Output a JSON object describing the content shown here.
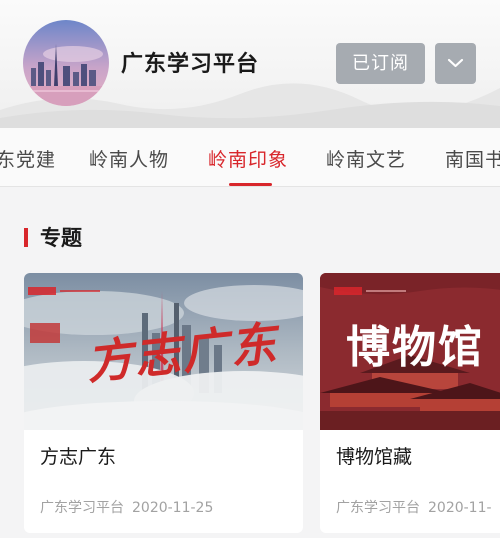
{
  "header": {
    "channel_name": "广东学习平台",
    "subscribe_label": "已订阅"
  },
  "tabs": [
    {
      "label": "东党建",
      "active": false
    },
    {
      "label": "岭南人物",
      "active": false
    },
    {
      "label": "岭南印象",
      "active": true
    },
    {
      "label": "岭南文艺",
      "active": false
    },
    {
      "label": "南国书",
      "active": false
    }
  ],
  "section": {
    "title": "专题",
    "cards": [
      {
        "title": "方志广东",
        "source": "广东学习平台",
        "date": "2020-11-25",
        "banner_text": "方志广东"
      },
      {
        "title": "博物馆藏",
        "source": "广东学习平台",
        "date": "2020-11-",
        "banner_text": "博物馆"
      }
    ]
  },
  "colors": {
    "accent": "#d8262b",
    "button_gray": "#a6abb1",
    "text_primary": "#1a1a1a",
    "text_secondary": "#a2a2a2"
  },
  "icons": {
    "dropdown": "chevron-down-icon",
    "avatar": "city-skyline-avatar"
  }
}
